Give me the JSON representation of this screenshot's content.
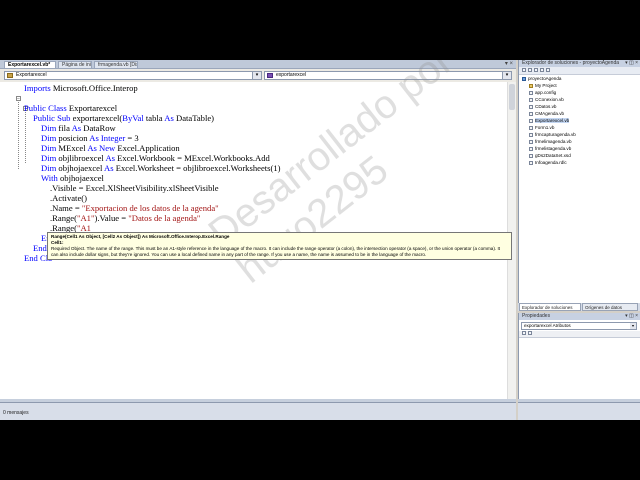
{
  "editor": {
    "tabs": [
      {
        "label": "Exportarexcel.vb*",
        "active": true
      },
      {
        "label": "Página de inicio",
        "active": false
      },
      {
        "label": "frmagenda.vb [Diseño]*",
        "active": false
      }
    ],
    "close_glyph": "▾ ×",
    "class_combo": "Exportarexcel",
    "method_combo": "exportarexcel",
    "combo_arrow": "▾",
    "lines": {
      "l1": [
        "Imports Microsoft.Office.Interop"
      ],
      "l3a": "Public Class",
      "l3b": " Exportarexcel",
      "l4a": "Public Sub",
      "l4b": " exportarexcel(",
      "l4c": "ByVal",
      "l4d": " tabla ",
      "l4e": "As",
      "l4f": " DataTable)",
      "l5a": "Dim",
      "l5b": " fila ",
      "l5c": "As",
      "l5d": " DataRow",
      "l6a": "Dim",
      "l6b": " posicion ",
      "l6c": "As Integer",
      "l6d": " = 3",
      "l7a": "Dim",
      "l7b": " MExcel ",
      "l7c": "As New",
      "l7d": " Excel.Application",
      "l8a": "Dim",
      "l8b": " objlibroexcel ",
      "l8c": "As",
      "l8d": " Excel.Workbook = MExcel.Workbooks.Add",
      "l9a": "Dim",
      "l9b": " objhojaexcel ",
      "l9c": "As",
      "l9d": " Excel.Worksheet = objlibroexcel.Worksheets(1)",
      "l10a": "With",
      "l10b": " objhojaexcel",
      "l11": ".Visible = Excel.XlSheetVisibility.xlSheetVisible",
      "l12": ".Activate()",
      "l13a": ".Name = ",
      "l13b": "\"Exportacion de los datos de la agenda\"",
      "l14a": ".Range(",
      "l14b": "\"A1\"",
      "l14c": ").Value = ",
      "l14d": "\"Datos de la agenda\"",
      "l15a": ".Range(",
      "l15b": "\"A1",
      "l16": "En",
      "l17": "End",
      "l18": "End Cla"
    },
    "tooltip": {
      "signature": "Range(Cell1 As Object, [Cell2 As Object]) As Microsoft.Office.Interop.Excel.Range",
      "param": "Cell1:",
      "description": "Required Object. The name of the range. This must be an A1-style reference in the language of the macro. It can include the range operator (a colon), the intersection operator (a space), or the union operator (a comma). It can also include dollar signs, but they're ignored. You can use a local defined name in any part of the range. If you use a name, the name is assumed to be in the language of the macro."
    },
    "watermark": "Desarrollado por\nhugo2295",
    "bottom_status": "0 mensajes"
  },
  "solution_explorer": {
    "title": "Explorador de soluciones - proyectoAgenda",
    "title_buttons": "▾ ◫ ×",
    "items": [
      {
        "label": "proyectoAgenda",
        "indent": 0,
        "icon": "project-icon"
      },
      {
        "label": "My Project",
        "indent": 1,
        "icon": "folder-icon"
      },
      {
        "label": "app.config",
        "indent": 1,
        "icon": "file-icon"
      },
      {
        "label": "CConexion.vb",
        "indent": 1,
        "icon": "file-icon"
      },
      {
        "label": "CDatos.vb",
        "indent": 1,
        "icon": "file-icon"
      },
      {
        "label": "CMAgenda.vb",
        "indent": 1,
        "icon": "file-icon"
      },
      {
        "label": "Exportarexcel.vb",
        "indent": 1,
        "icon": "file-icon",
        "selected": true
      },
      {
        "label": "Form1.vb",
        "indent": 1,
        "icon": "file-icon"
      },
      {
        "label": "frmcapturagenda.vb",
        "indent": 1,
        "icon": "file-icon"
      },
      {
        "label": "frmelimagenda.vb",
        "indent": 1,
        "icon": "file-icon"
      },
      {
        "label": "frmelistagenda.vb",
        "indent": 1,
        "icon": "file-icon"
      },
      {
        "label": "gDs2DataSet.xsd",
        "indent": 1,
        "icon": "file-icon"
      },
      {
        "label": "Infoagenda.rdlc",
        "indent": 1,
        "icon": "file-icon"
      }
    ],
    "tabs": [
      {
        "label": "Explorador de soluciones",
        "active": true
      },
      {
        "label": "Orígenes de datos",
        "active": false
      }
    ]
  },
  "properties": {
    "title": "Propiedades",
    "title_buttons": "▾ ◫ ×",
    "combo": "exportarexcel  Atributos",
    "combo_arrow": "▾"
  }
}
